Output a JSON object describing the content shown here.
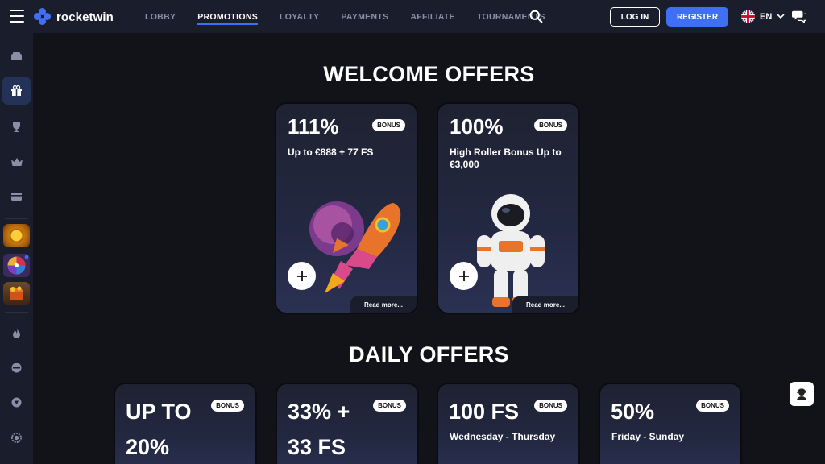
{
  "header": {
    "logo_text": "rocketwin",
    "nav": [
      "LOBBY",
      "PROMOTIONS",
      "LOYALTY",
      "PAYMENTS",
      "AFFILIATE",
      "TOURNAMENTS"
    ],
    "active_nav": "PROMOTIONS",
    "login_label": "LOG IN",
    "register_label": "REGISTER",
    "language": "EN",
    "accent_color": "#3f6ff5"
  },
  "sidebar": {
    "icons": [
      "slots-icon",
      "gift-icon",
      "trophy-icon",
      "crown-icon",
      "card-icon",
      "fire-icon",
      "sports-icon",
      "chip-icon",
      "settings-icon"
    ],
    "active": "gift-icon",
    "games": [
      "coin-game-tile",
      "wheel-game-tile",
      "treasure-game-tile"
    ]
  },
  "welcome": {
    "title": "WELCOME OFFERS",
    "cards": [
      {
        "percent": "111%",
        "badge": "BONUS",
        "text": "Up to €888 + 77 FS",
        "read_more": "Read more..."
      },
      {
        "percent": "100%",
        "badge": "BONUS",
        "text": "High Roller Bonus Up to €3,000",
        "read_more": "Read more..."
      }
    ]
  },
  "daily": {
    "title": "DAILY OFFERS",
    "cards": [
      {
        "headline_1": "UP TO",
        "headline_2": "20%",
        "badge": "BONUS",
        "text": ""
      },
      {
        "headline_1": "33% +",
        "headline_2": "33 FS",
        "badge": "BONUS",
        "text": ""
      },
      {
        "headline_1": "100 FS",
        "headline_2": "",
        "badge": "BONUS",
        "text": "Wednesday - Thursday"
      },
      {
        "headline_1": "50%",
        "headline_2": "",
        "badge": "BONUS",
        "text": "Friday - Sunday"
      }
    ]
  }
}
